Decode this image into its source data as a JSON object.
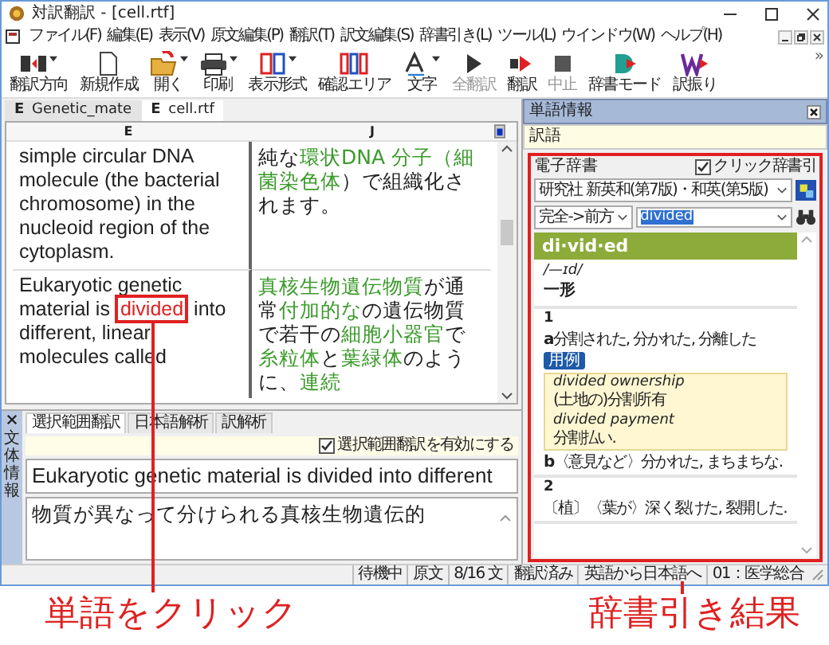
{
  "window": {
    "title": "対訳翻訳 - [cell.rtf]"
  },
  "menu": [
    "ファイル(F)",
    "編集(E)",
    "表示(V)",
    "原文編集(P)",
    "翻訳(T)",
    "訳文編集(S)",
    "辞書引き(L)",
    "ツール(L)",
    "ウインドウ(W)",
    "ヘルプ(H)"
  ],
  "toolbar": {
    "buttons": [
      {
        "label": "翻訳方向",
        "kind": "direction",
        "caret": true,
        "disabled": false
      },
      {
        "label": "新規作成",
        "kind": "new",
        "caret": false,
        "disabled": false
      },
      {
        "label": "開く",
        "kind": "open",
        "caret": true,
        "disabled": false
      },
      {
        "label": "印刷",
        "kind": "print",
        "caret": true,
        "disabled": false
      },
      {
        "label": "表示形式",
        "kind": "layout",
        "caret": true,
        "disabled": false
      },
      {
        "label": "確認エリア",
        "kind": "area",
        "caret": false,
        "disabled": false
      },
      {
        "label": "文字",
        "kind": "font",
        "caret": true,
        "disabled": false
      },
      {
        "label": "全翻訳",
        "kind": "play",
        "caret": false,
        "disabled": true
      },
      {
        "label": "翻訳",
        "kind": "translate",
        "caret": false,
        "disabled": false
      },
      {
        "label": "中止",
        "kind": "stop",
        "caret": false,
        "disabled": true
      },
      {
        "label": "辞書モード",
        "kind": "dict",
        "caret": false,
        "disabled": false
      },
      {
        "label": "訳振り",
        "kind": "wordmode",
        "caret": false,
        "disabled": false
      }
    ],
    "overflow": "»"
  },
  "doc_tabs": [
    {
      "badge": "E",
      "label": "Genetic_mate",
      "selected": false
    },
    {
      "badge": "E",
      "label": "cell.rtf",
      "selected": true
    }
  ],
  "document": {
    "columns": [
      "E",
      "J"
    ],
    "rows": [
      {
        "source": [
          {
            "text": "simple circular DNA molecule (the bacterial chromosome) in the nucleoid region of the cytoplasm.",
            "clicked": false
          }
        ],
        "target": [
          {
            "text": "純な",
            "term": false
          },
          {
            "text": "環状DNA 分子（細菌染色体",
            "term": true
          },
          {
            "text": "）で組織化されます。",
            "term": false
          }
        ]
      },
      {
        "source": [
          {
            "text": "Eukaryotic genetic material is ",
            "clicked": false
          },
          {
            "text": "divided",
            "clicked": true
          },
          {
            "text": " into different, linear molecules called",
            "clicked": false
          }
        ],
        "target": [
          {
            "text": "真核生物遺伝物質",
            "term": true
          },
          {
            "text": "が通常",
            "term": false
          },
          {
            "text": "付加的な",
            "term": true
          },
          {
            "text": "の遺伝物質で若干の",
            "term": false
          },
          {
            "text": "細胞小器官",
            "term": true
          },
          {
            "text": "で",
            "term": false
          },
          {
            "text": "糸粒体",
            "term": true
          },
          {
            "text": "と",
            "term": false
          },
          {
            "text": "葉緑体",
            "term": true
          },
          {
            "text": "のように、",
            "term": false
          },
          {
            "text": "連続",
            "term": true
          }
        ]
      }
    ]
  },
  "bottom_panel": {
    "side_label": "文体情報",
    "tabs": [
      {
        "label": "選択範囲翻訳",
        "selected": true
      },
      {
        "label": "日本語解析",
        "selected": false
      },
      {
        "label": "訳解析",
        "selected": false
      }
    ],
    "option": {
      "label": "選択範囲翻訳を有効にする",
      "checked": true
    },
    "source": "Eukaryotic genetic material is divided into different",
    "target": "物質が異なって分けられる真核生物遺伝的"
  },
  "word_info": {
    "title": "単語情報",
    "translation_label": "訳語",
    "dictionary": {
      "label": "電子辞書",
      "click_lookup": {
        "label": "クリック辞書引",
        "checked": true
      },
      "source": "研究社 新英和(第7版)・和英(第5版)",
      "mode": "完全->前方",
      "query": "divided",
      "headword": "di·vid·ed",
      "pronunciation": "/—ɪd/",
      "part_of_speech": "一形",
      "senses": [
        {
          "number": "1",
          "items": [
            {
              "letter": "a",
              "text": "分割された, 分かれた, 分離した",
              "example_label": "用例",
              "examples": [
                {
                  "en": "divided ownership",
                  "ja": "(土地の)分割所有"
                },
                {
                  "en": "divided payment",
                  "ja": "分割払い."
                }
              ]
            },
            {
              "letter": "b",
              "text": "〈意見など〉分かれた, まちまちな."
            }
          ]
        },
        {
          "number": "2",
          "items": [
            {
              "text": "〔植〕〈葉が〉深く裂けた, 裂開した."
            }
          ]
        }
      ]
    }
  },
  "status_bar": [
    "待機中",
    "原文",
    "8/16 文",
    "翻訳済み",
    "英語から日本語へ",
    "01：医学総合"
  ],
  "annotations": [
    "単語をクリック",
    "辞書引き結果"
  ]
}
